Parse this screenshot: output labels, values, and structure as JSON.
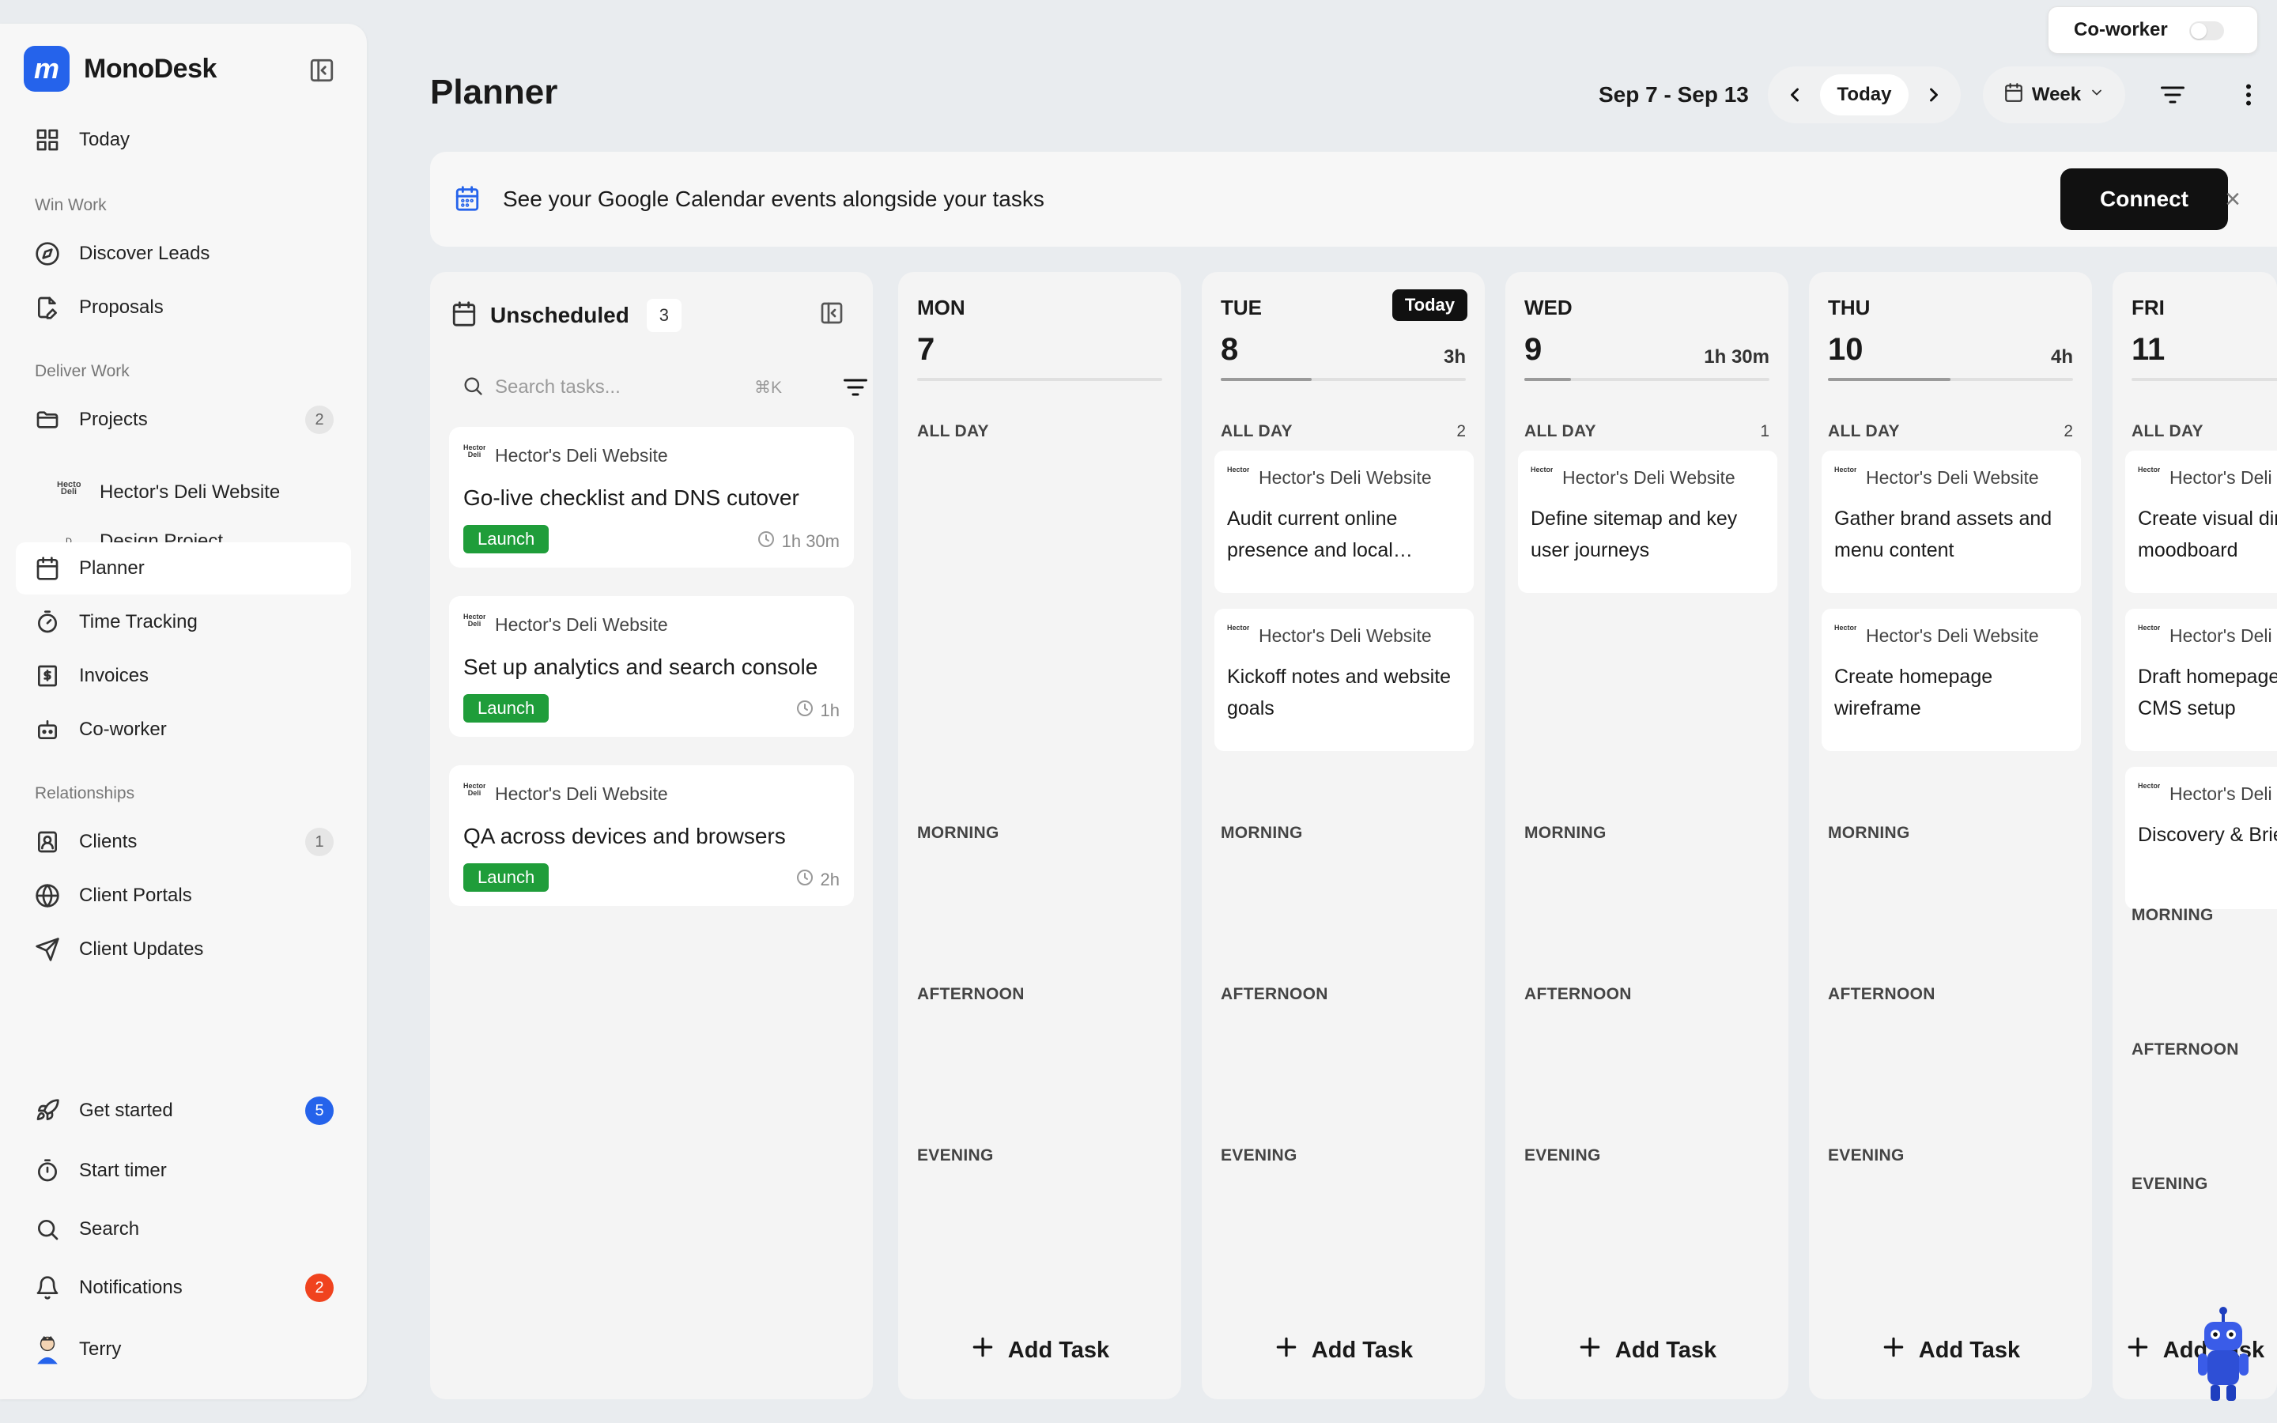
{
  "app": {
    "name": "MonoDesk",
    "logo_letter": "m"
  },
  "sidebar": {
    "today": "Today",
    "sections": {
      "win_work": "Win Work",
      "deliver_work": "Deliver Work",
      "relationships": "Relationships"
    },
    "items": {
      "discover_leads": "Discover Leads",
      "proposals": "Proposals",
      "projects": "Projects",
      "projects_count": "2",
      "project_hectors": "Hector's Deli Website",
      "project_design": "Design Project",
      "project_design_mark": "D",
      "planner": "Planner",
      "time_tracking": "Time Tracking",
      "invoices": "Invoices",
      "coworker": "Co-worker",
      "clients": "Clients",
      "clients_count": "1",
      "client_portals": "Client Portals",
      "client_updates": "Client Updates"
    },
    "bottom": {
      "get_started": "Get started",
      "get_started_count": "5",
      "start_timer": "Start timer",
      "search": "Search",
      "notifications": "Notifications",
      "notifications_count": "2",
      "user": "Terry"
    }
  },
  "header": {
    "title": "Planner",
    "date_range": "Sep 7 - Sep 13",
    "today_button": "Today",
    "view_button": "Week",
    "coworker_toggle": "Co-worker"
  },
  "banner": {
    "text": "See your Google Calendar events alongside your tasks",
    "connect": "Connect",
    "close": "×"
  },
  "unscheduled": {
    "title": "Unscheduled",
    "count": "3",
    "search_placeholder": "Search tasks...",
    "shortcut": "⌘K",
    "tasks": [
      {
        "project": "Hector's Deli Website",
        "title": "Go-live checklist and DNS cutover",
        "tag": "Launch",
        "duration": "1h 30m"
      },
      {
        "project": "Hector's Deli Website",
        "title": "Set up analytics and search console",
        "tag": "Launch",
        "duration": "1h"
      },
      {
        "project": "Hector's Deli Website",
        "title": "QA across devices and browsers",
        "tag": "Launch",
        "duration": "2h"
      }
    ]
  },
  "slots": {
    "all_day": "ALL DAY",
    "morning": "MORNING",
    "afternoon": "AFTERNOON",
    "evening": "EVENING"
  },
  "add_task": "Add Task",
  "today_badge": "Today",
  "project_logo_text": "Hector's Deli",
  "days": [
    {
      "name": "MON",
      "num": "7",
      "hours": "",
      "all_day_count": "",
      "progress": 0,
      "tasks": []
    },
    {
      "name": "TUE",
      "num": "8",
      "hours": "3h",
      "all_day_count": "2",
      "progress": 0.37,
      "tasks": [
        {
          "project": "Hector's Deli Website",
          "title": "Audit current online presence and local…"
        },
        {
          "project": "Hector's Deli Website",
          "title": "Kickoff notes and website goals"
        }
      ]
    },
    {
      "name": "WED",
      "num": "9",
      "hours": "1h 30m",
      "all_day_count": "1",
      "progress": 0.19,
      "tasks": [
        {
          "project": "Hector's Deli Website",
          "title": "Define sitemap and key user journeys"
        }
      ]
    },
    {
      "name": "THU",
      "num": "10",
      "hours": "4h",
      "all_day_count": "2",
      "progress": 0.5,
      "tasks": [
        {
          "project": "Hector's Deli Website",
          "title": "Gather brand assets and menu content"
        },
        {
          "project": "Hector's Deli Website",
          "title": "Create homepage wireframe"
        }
      ]
    },
    {
      "name": "FRI",
      "num": "11",
      "hours": "",
      "all_day_count": "",
      "progress": 0,
      "tasks": [
        {
          "project": "Hector's Deli Website",
          "title": "Create visual direction moodboard"
        },
        {
          "project": "Hector's Deli Website",
          "title": "Draft homepage copy and CMS setup"
        },
        {
          "project": "Hector's Deli Website",
          "title": "Discovery & Brief"
        }
      ]
    }
  ],
  "colors": {
    "accent": "#2563eb",
    "tag_green": "#1f9d3a",
    "badge_red": "#f0431e",
    "connect_bg": "#111111"
  }
}
